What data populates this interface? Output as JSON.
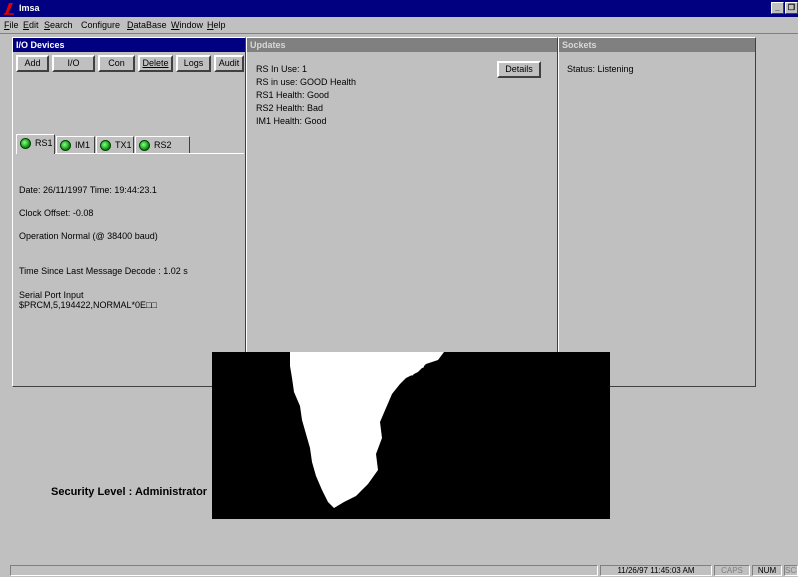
{
  "window": {
    "title": "Imsa",
    "icon": "imsa-logo-icon",
    "controls": [
      "minimize-icon",
      "restore-icon"
    ]
  },
  "menu": [
    {
      "label": "File",
      "ul": "F",
      "rest": "ile"
    },
    {
      "label": "Edit",
      "ul": "E",
      "rest": "dit"
    },
    {
      "label": "Search",
      "ul": "S",
      "rest": "earch"
    },
    {
      "label": "Configure",
      "ul": "",
      "rest": "Configure"
    },
    {
      "label": "DataBase",
      "ul": "D",
      "rest": "ataBase"
    },
    {
      "label": "Window",
      "ul": "W",
      "rest": "indow"
    },
    {
      "label": "Help",
      "ul": "H",
      "rest": "elp"
    }
  ],
  "io_devices": {
    "title": "I/O Devices",
    "buttons": {
      "add": "Add",
      "io": "I/O",
      "con": "Con",
      "delete": "Delete",
      "logs": "Logs",
      "audit": "Audit"
    },
    "tabs": [
      "RS1",
      "IM1",
      "TX1",
      "RS2"
    ],
    "selected_tab": "RS1",
    "date_time": "Date: 26/11/1997  Time: 19:44:23.1",
    "clock_offset": "Clock Offset: -0.08",
    "operation": "Operation Normal (@ 38400 baud)",
    "time_since": "Time Since Last Message Decode : 1.02 s",
    "serial_label": "Serial Port Input",
    "serial_value": "$PRCM,5,194422,NORMAL*0E□□"
  },
  "updates": {
    "title": "Updates",
    "details_label": "Details",
    "lines": [
      "RS In Use: 1",
      "RS in use: GOOD Health",
      "RS1 Health: Good",
      "RS2 Health: Bad",
      "IM1 Health: Good"
    ]
  },
  "sockets": {
    "title": "Sockets",
    "status": "Status: Listening"
  },
  "security": "Security Level : Administrator",
  "statusbar": {
    "datetime": "11/26/97 11:45:03 AM",
    "caps": "CAPS",
    "num": "NUM",
    "scrl": "SCRL"
  },
  "colors": {
    "active_title": "#000080",
    "inactive_title": "#808080",
    "face": "#c0c0c0",
    "led_green": "#00a000"
  }
}
